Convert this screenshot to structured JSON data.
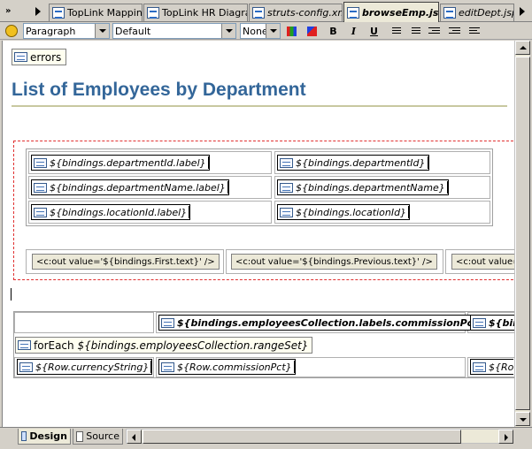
{
  "tabs": [
    {
      "label": "TopLink Mappings",
      "active": false
    },
    {
      "label": "TopLink HR Diagram",
      "active": false
    },
    {
      "label": "struts-config.xml",
      "active": false
    },
    {
      "label": "browseEmp.jsp",
      "active": true
    },
    {
      "label": "editDept.jsp",
      "active": false
    }
  ],
  "toolbar": {
    "style": "Paragraph",
    "font": "Default",
    "size": "None",
    "bold": "B",
    "italic": "I",
    "underline": "U"
  },
  "editor": {
    "errors_tag": "errors",
    "heading": "List of Employees by Department",
    "rows": [
      {
        "label": "${bindings.departmentId.label}",
        "value": "${bindings.departmentId}"
      },
      {
        "label": "${bindings.departmentName.label}",
        "value": "${bindings.departmentName}"
      },
      {
        "label": "${bindings.locationId.label}",
        "value": "${bindings.locationId}"
      }
    ],
    "nav_buttons": [
      "<c:out value='${bindings.First.text}' />",
      "<c:out value='${bindings.Previous.text}' />",
      "<c:out value="
    ],
    "table_header": [
      "${bindings.employeesCollection.labels.commissionPct}",
      "${bin"
    ],
    "foreach_keyword": "forEach",
    "foreach_expr": "${bindings.employeesCollection.rangeSet}",
    "table_row": [
      "${Row.currencyString}",
      "${Row.commissionPct}",
      "${Ro"
    ]
  },
  "bottom_tabs": [
    {
      "label": "Design",
      "active": true
    },
    {
      "label": "Source",
      "active": false
    }
  ],
  "colors": {
    "heading": "#336699",
    "dotted_border": "#e03030",
    "heading_rule": "#c8c8a0"
  }
}
